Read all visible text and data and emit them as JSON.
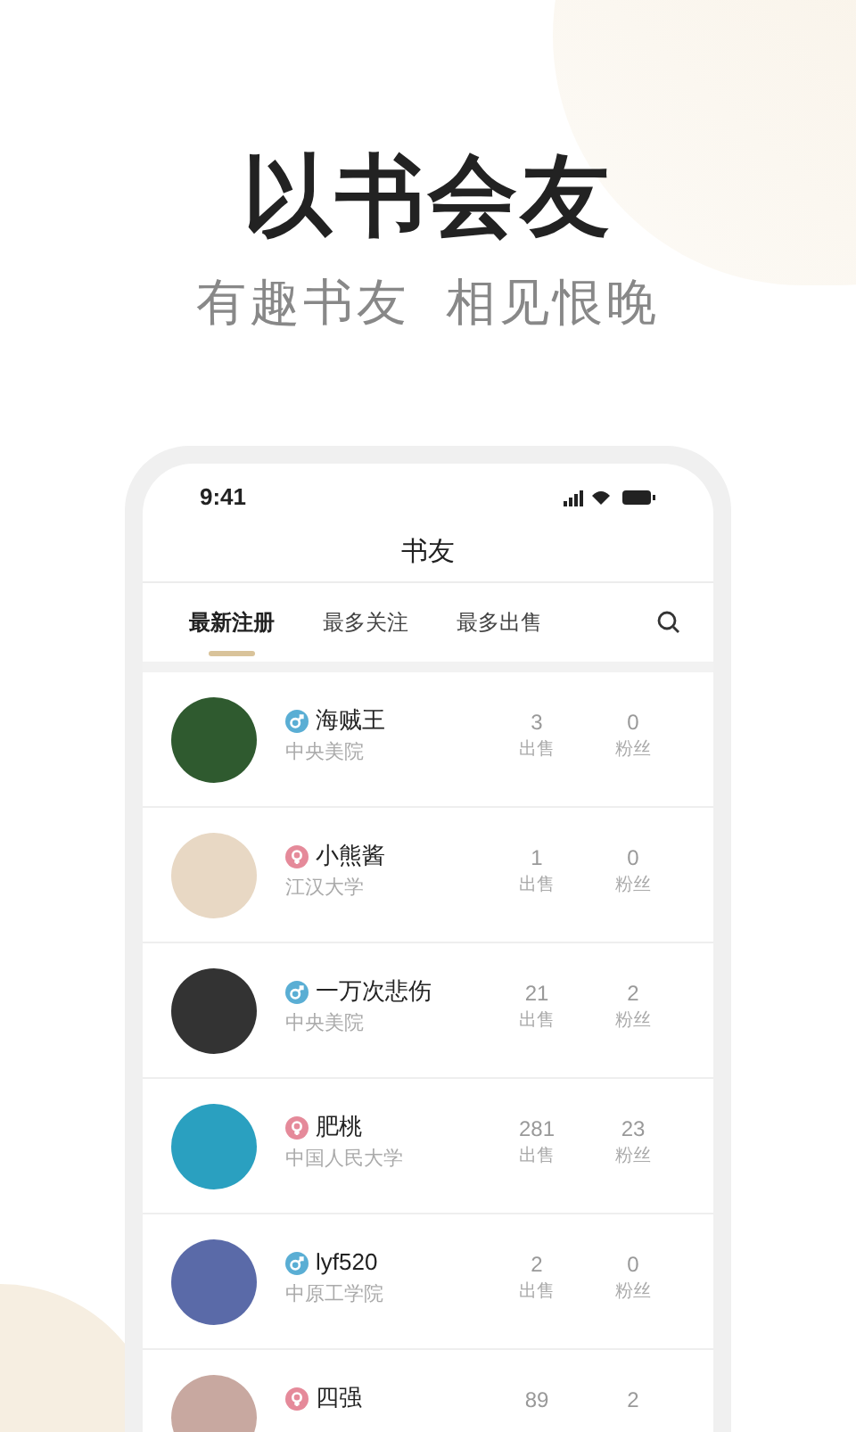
{
  "headline": "以书会友",
  "subtitle": "有趣书友  相见恨晚",
  "status_bar": {
    "time": "9:41"
  },
  "screen_title": "书友",
  "tabs": [
    {
      "label": "最新注册",
      "selected": true
    },
    {
      "label": "最多关注",
      "selected": false
    },
    {
      "label": "最多出售",
      "selected": false
    }
  ],
  "users": [
    {
      "name": "海贼王",
      "kind": "male",
      "school": "中央美院",
      "stats": [
        {
          "value": "3",
          "label": "出售"
        },
        {
          "value": "0",
          "label": "粉丝"
        }
      ]
    },
    {
      "name": "小熊酱",
      "kind": "female",
      "school": "江汉大学",
      "stats": [
        {
          "value": "1",
          "label": "出售"
        },
        {
          "value": "0",
          "label": "粉丝"
        }
      ]
    },
    {
      "name": "一万次悲伤",
      "kind": "male",
      "school": "中央美院",
      "stats": [
        {
          "value": "21",
          "label": "出售"
        },
        {
          "value": "2",
          "label": "粉丝"
        }
      ]
    },
    {
      "name": "肥桃",
      "kind": "female",
      "school": "中国人民大学",
      "stats": [
        {
          "value": "281",
          "label": "出售"
        },
        {
          "value": "23",
          "label": "粉丝"
        }
      ]
    },
    {
      "name": "lyf520",
      "kind": "male",
      "school": "中原工学院",
      "stats": [
        {
          "value": "2",
          "label": "出售"
        },
        {
          "value": "0",
          "label": "粉丝"
        }
      ]
    },
    {
      "name": "四强",
      "kind": "female",
      "stats": [
        {
          "value": "89"
        },
        {
          "value": "2"
        }
      ]
    }
  ]
}
